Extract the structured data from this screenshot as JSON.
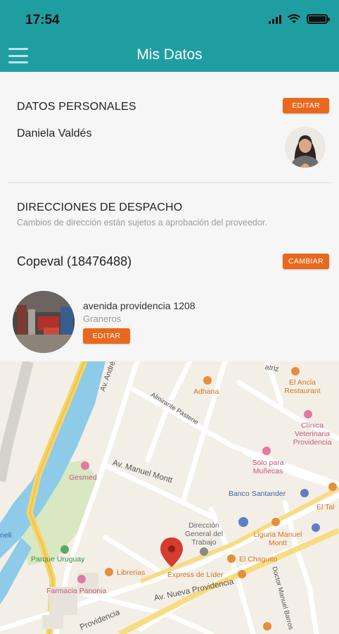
{
  "status_bar": {
    "time": "17:54"
  },
  "header": {
    "title": "Mis Datos"
  },
  "personal": {
    "section_title": "DATOS PERSONALES",
    "edit_label": "EDITAR",
    "name": "Daniela Valdés"
  },
  "shipping": {
    "section_title": "DIRECCIONES DE DESPACHO",
    "note": "Cambios de dirección están sujetos a aprobación del proveedor.",
    "provider": "Copeval (18476488)",
    "change_label": "CAMBIAR",
    "address": "avenida providencia 1208",
    "city": "Graneros",
    "edit_label": "EDITAR"
  },
  "map": {
    "streets": {
      "andres_bello": "Av. Andrés Bello",
      "almirante_pastene": "Almirante Pastene",
      "manuel_montt": "Av. Manuel Montt",
      "nueva_providencia": "Av. Nueva Providencia",
      "providencia": "Providencia",
      "manuel_barros": "Doctor Manuel Barros",
      "patriz": "atriz"
    },
    "pois": {
      "adhana": "Adhana",
      "el_ancla": "El Ancla Restaurant",
      "clinica": "Clínica Veterinaria Providencia",
      "solo_para_munecas": "Sólo para Muñecas",
      "gesmed": "Gesmed",
      "banco_santander": "Banco Santander",
      "el_tal": "El Tal",
      "direccion_trabajo": "Dirección General del Trabajo",
      "liguria": "Liguria Manuel Montt",
      "parque_uruguay": "Parque Uruguay",
      "el_chaguito": "El Chaguito",
      "librerias": "Librerias",
      "express_lider": "Express de Líder",
      "farmacia_panonia": "Farmacia Panonia",
      "nell": "nell"
    }
  },
  "colors": {
    "primary": "#1f9ea2",
    "accent": "#e8691d",
    "marker": "#d63b30"
  }
}
